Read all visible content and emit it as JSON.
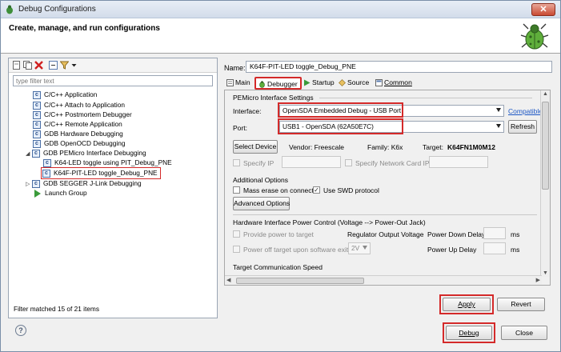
{
  "window": {
    "title": "Debug Configurations",
    "close_glyph": "✕"
  },
  "header": {
    "title": "Create, manage, and run configurations",
    "icon": "bug-icon"
  },
  "left": {
    "filter_placeholder": "type filter text",
    "items": [
      {
        "label": "C/C++ Application",
        "icon": "c-config-icon"
      },
      {
        "label": "C/C++ Attach to Application",
        "icon": "c-config-icon"
      },
      {
        "label": "C/C++ Postmortem Debugger",
        "icon": "c-config-icon"
      },
      {
        "label": "C/C++ Remote Application",
        "icon": "c-config-icon"
      },
      {
        "label": "GDB Hardware Debugging",
        "icon": "c-config-icon"
      },
      {
        "label": "GDB OpenOCD Debugging",
        "icon": "c-config-icon"
      },
      {
        "label": "GDB PEMicro Interface Debugging",
        "icon": "c-config-icon",
        "expanded": true
      },
      {
        "label": "K64-LED toggle using PIT_Debug_PNE",
        "icon": "c-config-icon",
        "child": true
      },
      {
        "label": "K64F-PIT-LED toggle_Debug_PNE",
        "icon": "c-config-icon",
        "child": true,
        "selected": true
      },
      {
        "label": "GDB SEGGER J-Link Debugging",
        "icon": "c-config-icon",
        "collapsed": true
      },
      {
        "label": "Launch Group",
        "icon": "launch-group-icon"
      }
    ],
    "status": "Filter matched 15 of 21 items"
  },
  "right": {
    "name_label": "Name:",
    "name_value": "K64F-PIT-LED toggle_Debug_PNE",
    "tabs": [
      {
        "label": "Main",
        "icon": "main-tab-icon"
      },
      {
        "label": "Debugger",
        "icon": "debugger-tab-icon",
        "active": true
      },
      {
        "label": "Startup",
        "icon": "startup-tab-icon"
      },
      {
        "label": "Source",
        "icon": "source-tab-icon"
      },
      {
        "label": "Common",
        "icon": "common-tab-icon"
      }
    ],
    "pemicro": {
      "section": "PEMicro Interface Settings",
      "interface_label": "Interface:",
      "interface_value": "OpenSDA Embedded Debug - USB Port",
      "compatible_link": "Compatible",
      "port_label": "Port:",
      "port_value": "USB1 - OpenSDA (62A50E7C)",
      "refresh": "Refresh",
      "select_device": "Select Device",
      "vendor": "Vendor: Freescale",
      "family": "Family: K6x",
      "target_label": "Target:",
      "target_value": "K64FN1M0M12",
      "specify_ip": "Specify IP",
      "specify_nc_ip": "Specify Network Card IP"
    },
    "additional": {
      "section": "Additional Options",
      "mass_erase": "Mass erase on connect",
      "use_swd": "Use SWD protocol",
      "use_swd_checked": "✓",
      "advanced": "Advanced Options"
    },
    "power": {
      "section": "Hardware Interface Power Control (Voltage --> Power-Out Jack)",
      "provide_power": "Provide power to target",
      "reg_voltage": "Regulator Output Voltage",
      "power_down_delay": "Power Down Delay",
      "ms1": "ms",
      "power_off_exit": "Power off target upon software exit",
      "voltage": "2V",
      "power_up_delay": "Power Up Delay",
      "ms2": "ms"
    },
    "speed_section": "Target Communication Speed",
    "apply": "Apply",
    "revert": "Revert"
  },
  "footer": {
    "help": "?",
    "debug": "Debug",
    "close": "Close"
  },
  "colors": {
    "highlight": "#d42a2a",
    "link": "#1a55c4"
  }
}
